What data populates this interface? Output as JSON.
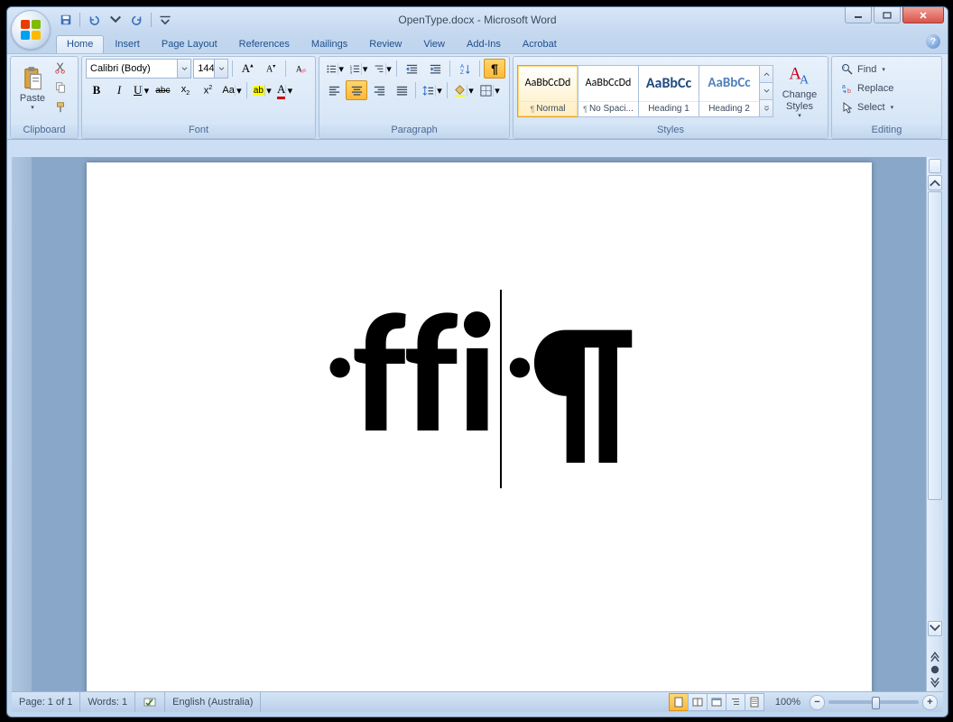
{
  "title": "OpenType.docx - Microsoft Word",
  "qat": {
    "save": "Save",
    "undo": "Undo",
    "redo": "Redo"
  },
  "tabs": [
    "Home",
    "Insert",
    "Page Layout",
    "References",
    "Mailings",
    "Review",
    "View",
    "Add-Ins",
    "Acrobat"
  ],
  "active_tab": "Home",
  "ribbon": {
    "clipboard": {
      "label": "Clipboard",
      "paste": "Paste"
    },
    "font": {
      "label": "Font",
      "name": "Calibri (Body)",
      "size": "144",
      "bold": "B",
      "italic": "I",
      "underline": "U",
      "strike": "abc",
      "sub": "x",
      "sup": "x",
      "case": "Aa",
      "highlight": "ab",
      "color": "A",
      "grow": "A",
      "shrink": "A",
      "clear": "Clear"
    },
    "paragraph": {
      "label": "Paragraph"
    },
    "styles": {
      "label": "Styles",
      "items": [
        {
          "preview": "AaBbCcDd",
          "name": "Normal",
          "pilcrow": true,
          "selected": true,
          "color": "#000",
          "size": "12px"
        },
        {
          "preview": "AaBbCcDd",
          "name": "No Spaci...",
          "pilcrow": true,
          "selected": false,
          "color": "#000",
          "size": "12px"
        },
        {
          "preview": "AaBbCc",
          "name": "Heading 1",
          "pilcrow": false,
          "selected": false,
          "color": "#1f497d",
          "size": "16px",
          "bold": true
        },
        {
          "preview": "AaBbCc",
          "name": "Heading 2",
          "pilcrow": false,
          "selected": false,
          "color": "#4f81bd",
          "size": "15px",
          "bold": true
        }
      ],
      "change": "Change Styles"
    },
    "editing": {
      "label": "Editing",
      "find": "Find",
      "replace": "Replace",
      "select": "Select"
    }
  },
  "document": {
    "text": "ffi"
  },
  "status": {
    "page": "Page: 1 of 1",
    "words": "Words: 1",
    "lang": "English (Australia)",
    "zoom": "100%"
  }
}
